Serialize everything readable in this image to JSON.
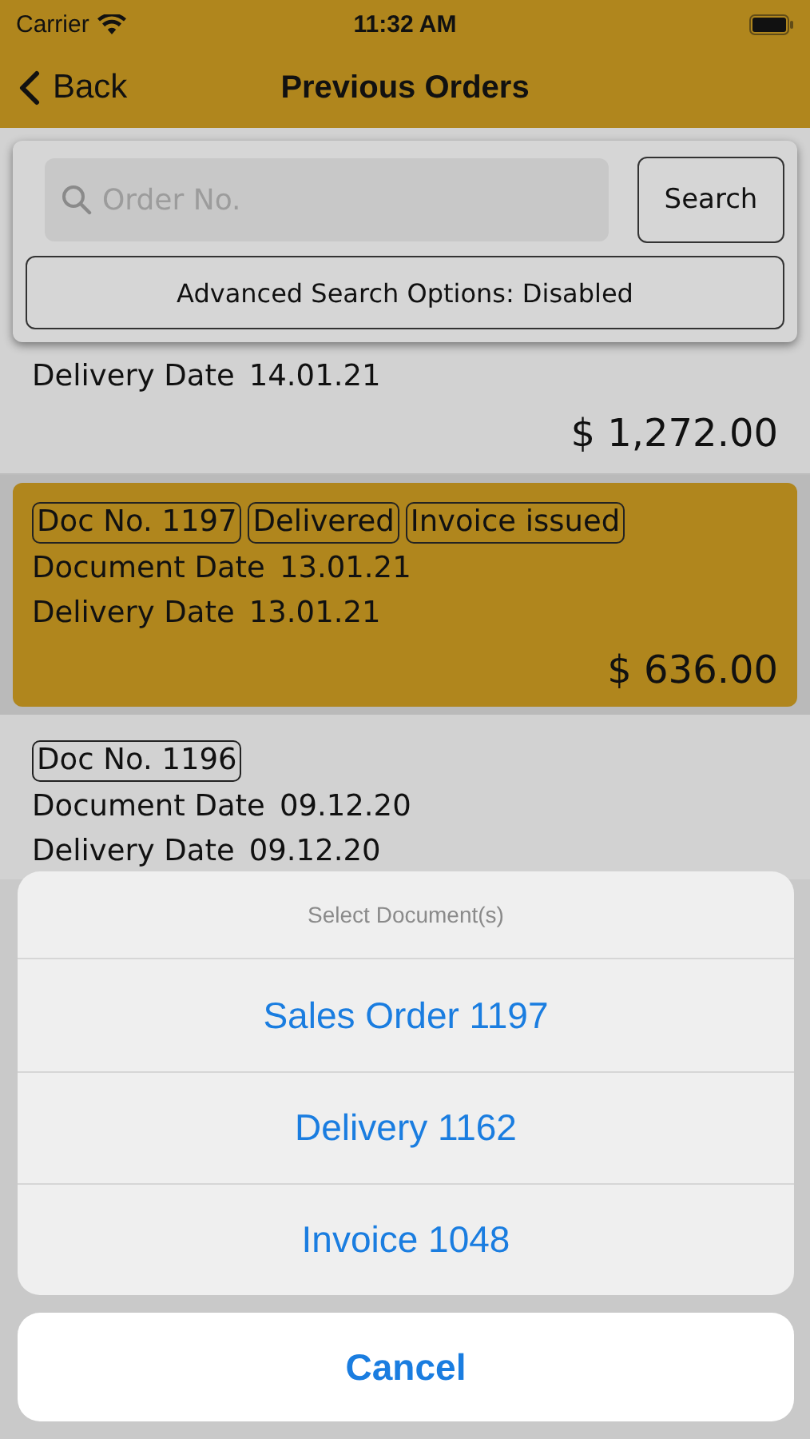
{
  "status_bar": {
    "carrier": "Carrier",
    "time": "11:32 AM"
  },
  "nav_bar": {
    "back": "Back",
    "title": "Previous Orders"
  },
  "search": {
    "placeholder": "Order No.",
    "button": "Search",
    "advanced": "Advanced Search Options: Disabled"
  },
  "orders": [
    {
      "selected": false,
      "delivery_label": "Delivery Date",
      "delivery_date": "14.01.21",
      "amount": "$ 1,272.00"
    },
    {
      "selected": true,
      "tags": [
        "Doc No. 1197",
        "Delivered",
        "Invoice issued"
      ],
      "document_label": "Document Date",
      "document_date": "13.01.21",
      "delivery_label": "Delivery Date",
      "delivery_date": "13.01.21",
      "amount": "$ 636.00"
    },
    {
      "selected": false,
      "tags": [
        "Doc No. 1196"
      ],
      "document_label": "Document Date",
      "document_date": "09.12.20",
      "delivery_label": "Delivery Date",
      "delivery_date": "09.12.20"
    }
  ],
  "action_sheet": {
    "title": "Select Document(s)",
    "actions": [
      "Sales Order 1197",
      "Delivery 1162",
      "Invoice 1048"
    ],
    "cancel": "Cancel"
  }
}
